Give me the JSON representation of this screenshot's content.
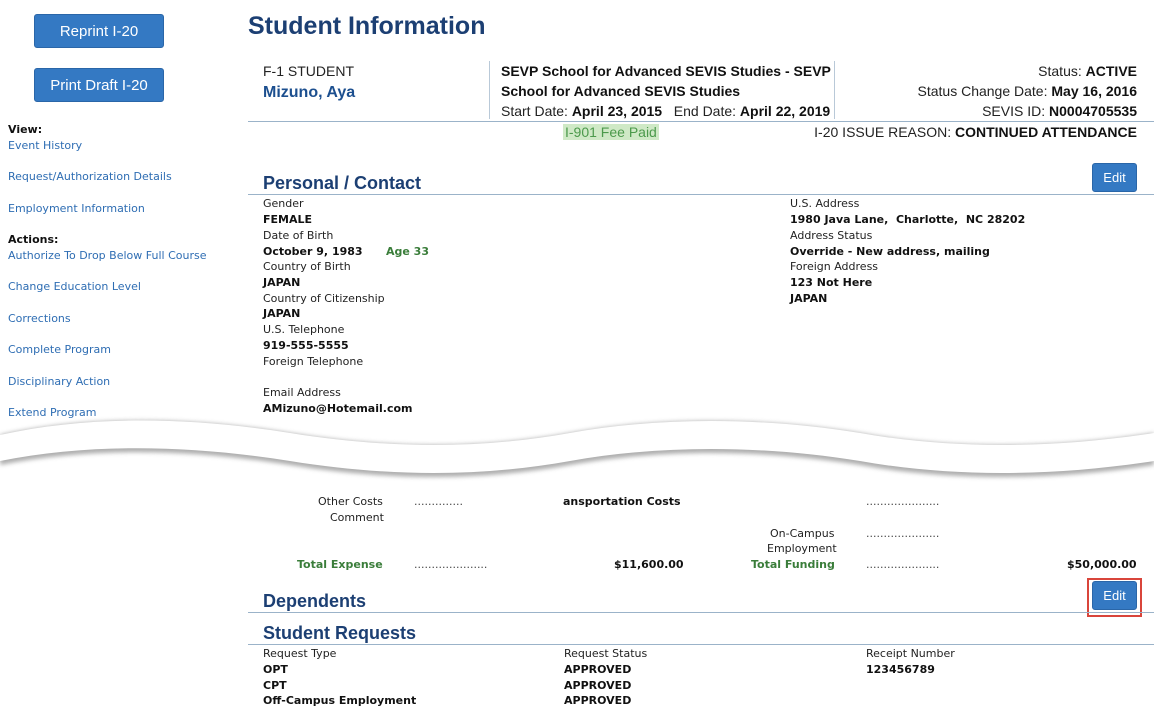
{
  "sidebar": {
    "reprint_label": "Reprint I-20",
    "print_draft_label": "Print Draft I-20",
    "view_heading": "View:",
    "view_links": [
      "Event History",
      "Request/Authorization Details",
      "Employment Information"
    ],
    "actions_heading": "Actions:",
    "action_links": [
      "Authorize To Drop Below Full Course",
      "Change Education Level",
      "Corrections",
      "Complete Program",
      "Disciplinary Action",
      "Extend Program"
    ]
  },
  "page_title": "Student Information",
  "header": {
    "student_type": "F-1 STUDENT",
    "student_name": "Mizuno, Aya",
    "school_line1": "SEVP School for Advanced SEVIS Studies - SEVP",
    "school_line2": "School for Advanced SEVIS Studies",
    "start_label": "Start Date:",
    "start_value": "April 23, 2015",
    "end_label": "End Date:",
    "end_value": "April 22, 2019",
    "status_label": "Status:",
    "status_value": "ACTIVE",
    "status_change_label": "Status Change Date:",
    "status_change_value": "May 16, 2016",
    "sevis_label": "SEVIS ID:",
    "sevis_value": "N0004705535",
    "fee_badge": "I-901 Fee Paid",
    "issue_reason_label": "I-20 ISSUE REASON:",
    "issue_reason_value": "CONTINUED ATTENDANCE"
  },
  "personal": {
    "section_title": "Personal / Contact",
    "edit_label": "Edit",
    "gender_label": "Gender",
    "gender_value": "FEMALE",
    "dob_label": "Date of Birth",
    "dob_value": "October 9, 1983",
    "age_value": "Age 33",
    "birth_country_label": "Country of Birth",
    "birth_country_value": "JAPAN",
    "citizenship_label": "Country of Citizenship",
    "citizenship_value": "JAPAN",
    "us_phone_label": "U.S. Telephone",
    "us_phone_value": "919-555-5555",
    "foreign_phone_label": "Foreign Telephone",
    "email_label": "Email Address",
    "email_value": "AMizuno@Hotemail.com",
    "us_address_label": "U.S. Address",
    "us_address_value": "1980 Java Lane,  Charlotte,  NC 28202",
    "address_status_label": "Address Status",
    "address_status_value": "Override - New address, mailing",
    "foreign_address_label": "Foreign Address",
    "foreign_address_line1": "123 Not Here",
    "foreign_address_line2": "JAPAN"
  },
  "financial": {
    "other_costs_label": "Other Costs",
    "comment_label": "Comment",
    "transport_label": "ansportation Costs",
    "oncampus_label_1": "On-Campus",
    "oncampus_label_2": "Employment",
    "total_expense_label": "Total Expense",
    "total_expense_value": "$11,600.00",
    "total_funding_label": "Total Funding",
    "total_funding_value": "$50,000.00",
    "dots_short": "..............",
    "dots_long": "....................."
  },
  "dependents": {
    "section_title": "Dependents",
    "edit_label": "Edit"
  },
  "requests": {
    "section_title": "Student Requests",
    "columns": [
      "Request Type",
      "Request Status",
      "Receipt Number"
    ],
    "rows": [
      [
        "OPT",
        "APPROVED",
        "123456789"
      ],
      [
        "CPT",
        "APPROVED",
        ""
      ],
      [
        "Off-Campus Employment",
        "APPROVED",
        ""
      ]
    ]
  },
  "colors": {
    "accent": "#3479c3",
    "title": "#1c3f73",
    "link": "#2e6db3",
    "highlight": "#d9453b",
    "fee_bg": "#cfe9c6"
  }
}
